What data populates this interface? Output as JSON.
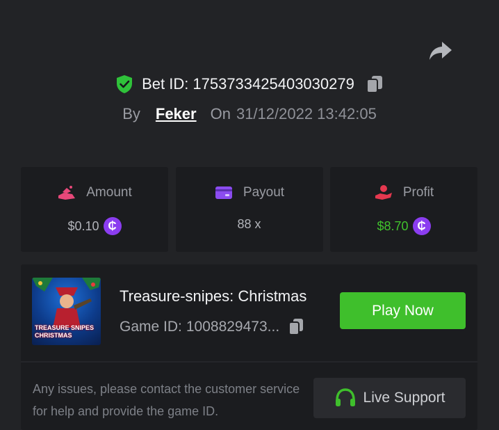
{
  "bet": {
    "id_label": "Bet ID:",
    "id_value": "1753733425403030279",
    "by_label": "By",
    "username": "Feker",
    "on_label": "On",
    "datetime": "31/12/2022 13:42:05"
  },
  "stats": {
    "amount": {
      "label": "Amount",
      "value": "$0.10",
      "currency_symbol": "₵",
      "icon": "money-hand-icon",
      "icon_color": "#e8487a"
    },
    "payout": {
      "label": "Payout",
      "value": "88 x",
      "icon": "wallet-card-icon",
      "icon_color": "#8b4cf0"
    },
    "profit": {
      "label": "Profit",
      "value": "$8.70",
      "currency_symbol": "₵",
      "icon": "hand-profit-icon",
      "icon_color": "#e5384f",
      "value_color": "#41c32d"
    }
  },
  "game": {
    "title": "Treasure-snipes: Christmas",
    "thumb_text": "TREASURE SNIPES CHRISTMAS",
    "id_label": "Game ID:",
    "id_value": "1008829473...",
    "play_label": "Play Now",
    "help_text": "Any issues, please contact the customer service for help and provide the game ID.",
    "support_label": "Live Support"
  },
  "colors": {
    "background": "#222326",
    "card": "#1b1c1f",
    "accent_green": "#3fbf2c",
    "coin_purple": "#8b3df0",
    "shield_green": "#2fc23a"
  }
}
